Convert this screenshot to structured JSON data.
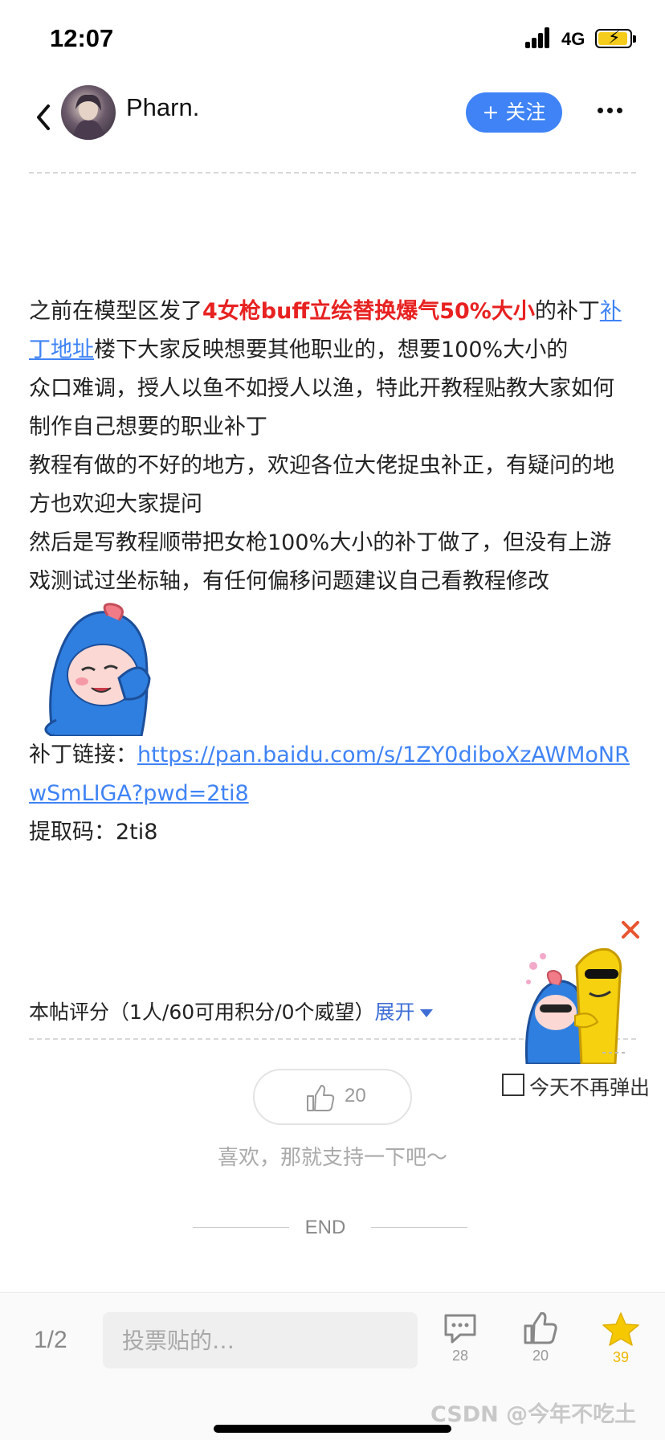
{
  "status_bar": {
    "time": "12:07",
    "network": "4G"
  },
  "header": {
    "username": "Pharn.",
    "follow_label": "+ 关注"
  },
  "article": {
    "p1_before": "之前在模型区发了",
    "p1_highlight": "4女枪buff立绘替换爆气50%大小",
    "p1_after": "的补丁",
    "p1_link": "补丁地址",
    "p1_rest": "楼下大家反映想要其他职业的，想要100%大小的",
    "p2": "众口难调，授人以鱼不如授人以渔，特此开教程贴教大家如何制作自己想要的职业补丁",
    "p3": "教程有做的不好的地方，欢迎各位大佬捉虫补正，有疑问的地方也欢迎大家提问",
    "p4": "然后是写教程顺带把女枪100%大小的补丁做了，但没有上游戏测试过坐标轴，有任何偏移问题建议自己看教程修改",
    "patch_label": "补丁链接：",
    "patch_url": "https://pan.baidu.com/s/1ZY0diboXzAWMoNRwSmLIGA?pwd=2ti8",
    "code_label": "提取码：",
    "code": "2ti8"
  },
  "rating": {
    "text": "本帖评分（1人/60可用积分/0个威望）",
    "expand_label": "展开"
  },
  "like": {
    "count": "20",
    "support_text": "喜欢，那就支持一下吧～",
    "end_label": "END"
  },
  "popup": {
    "no_popup_label": "今天不再弹出"
  },
  "bottom_bar": {
    "page_indicator": "1/2",
    "vote_placeholder": "投票贴的…",
    "comments_count": "28",
    "likes_count": "20",
    "favorites_count": "39"
  },
  "watermark": "CSDN @今年不吃土",
  "colors": {
    "accent": "#3f83f6",
    "highlight": "#e82121",
    "star": "#f5c800"
  }
}
